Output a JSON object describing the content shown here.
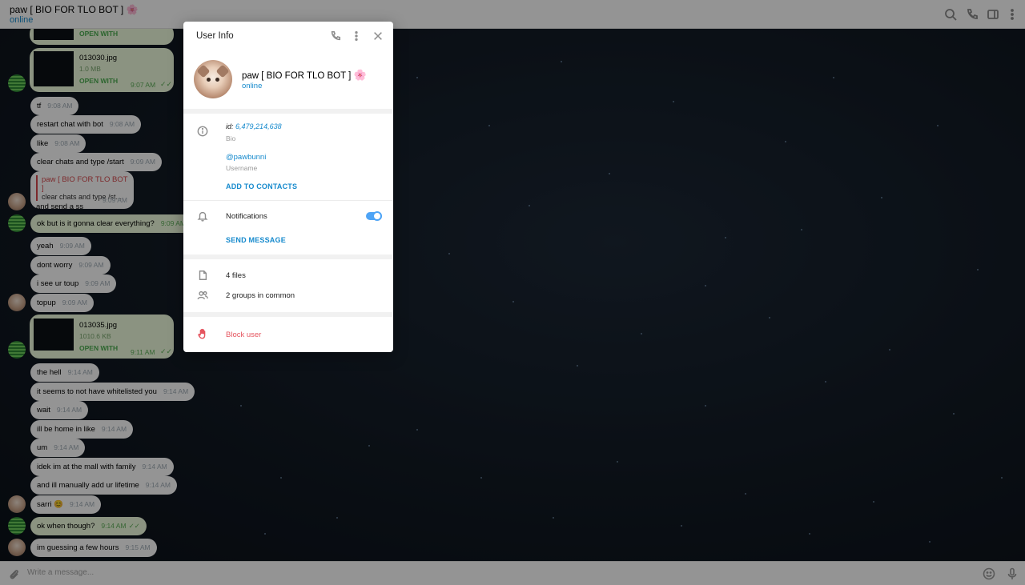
{
  "header": {
    "title": "paw [ BIO FOR TLO BOT ] 🌸",
    "status": "online"
  },
  "messages": [
    {
      "text": "tf",
      "time": "9:08 AM"
    },
    {
      "text": "restart chat with bot",
      "time": "9:08 AM"
    },
    {
      "text": "like",
      "time": "9:08 AM"
    },
    {
      "text": "clear chats and type /start",
      "time": "9:09 AM"
    },
    {
      "reply_name": "paw [ BIO FOR TLO BOT ]",
      "reply_text": "clear chats and type /st...",
      "text": "and send a ss",
      "time": "9:09 AM"
    },
    {
      "text": "ok but is it gonna clear everything?",
      "time": "9:09 AM"
    },
    {
      "text": "yeah",
      "time": "9:09 AM"
    },
    {
      "text": "dont worry",
      "time": "9:09 AM"
    },
    {
      "text": "i see ur toup",
      "time": "9:09 AM"
    },
    {
      "text": "topup",
      "time": "9:09 AM"
    },
    {
      "text": "the hell",
      "time": "9:14 AM"
    },
    {
      "text": "it seems to not have whitelisted you",
      "time": "9:14 AM"
    },
    {
      "text": "wait",
      "time": "9:14 AM"
    },
    {
      "text": "ill be home in like",
      "time": "9:14 AM"
    },
    {
      "text": "um",
      "time": "9:14 AM"
    },
    {
      "text": "idek im at the mall with family",
      "time": "9:14 AM"
    },
    {
      "text": "and ill manually add ur lifetime",
      "time": "9:14 AM"
    },
    {
      "text": "sarri 😊",
      "time": "9:14 AM"
    },
    {
      "text": "ok when though?",
      "time": "9:14 AM"
    },
    {
      "text": "im guessing a few hours",
      "time": "9:15 AM"
    }
  ],
  "files": [
    {
      "open_label": "OPEN WITH"
    },
    {
      "name": "013030.jpg",
      "size": "1.0 MB",
      "open_label": "OPEN WITH",
      "time": "9:07 AM"
    },
    {
      "name": "013035.jpg",
      "size": "1010.6 KB",
      "open_label": "OPEN WITH",
      "time": "9:11 AM"
    }
  ],
  "composer": {
    "placeholder": "Write a message..."
  },
  "modal": {
    "title": "User Info",
    "name": "paw [ BIO FOR TLO BOT ]",
    "name_emoji": "🌸",
    "status": "online",
    "id_label": "id:",
    "id_value": "6,479,214,638",
    "bio_label": "Bio",
    "username": "@pawbunni",
    "username_label": "Username",
    "add_contacts": "ADD TO CONTACTS",
    "notifications_label": "Notifications",
    "notifications_on": true,
    "send_message": "SEND MESSAGE",
    "files": "4 files",
    "groups": "2 groups in common",
    "block": "Block user"
  },
  "colors": {
    "accent": "#168acd",
    "toggle": "#4ea4f6",
    "danger": "#e5555f",
    "outgoing_bubble": "#effdde"
  }
}
